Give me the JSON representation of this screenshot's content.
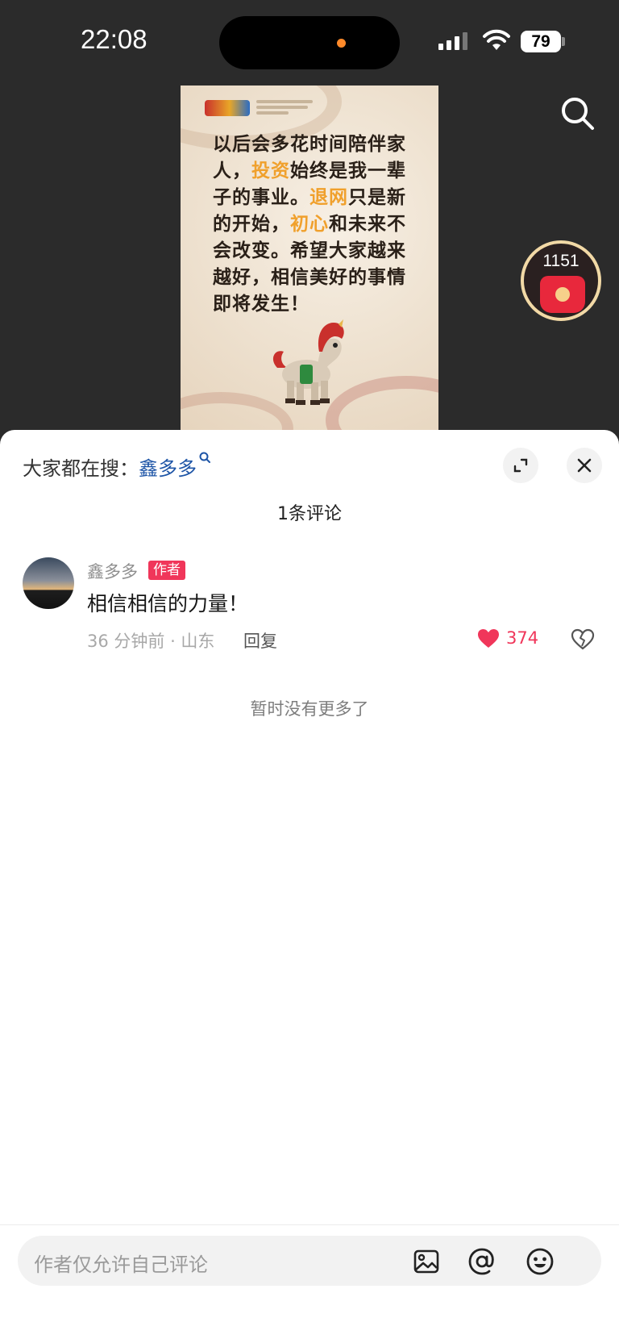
{
  "status_bar": {
    "time": "22:08",
    "battery": "79"
  },
  "poster": {
    "lines": [
      [
        {
          "t": "以后会多花时间陪伴家"
        }
      ],
      [
        {
          "t": "人，"
        },
        {
          "t": "投资",
          "hl": true
        },
        {
          "t": "始终是我一辈"
        }
      ],
      [
        {
          "t": "子的事业。"
        },
        {
          "t": "退网",
          "hl": true
        },
        {
          "t": "只是新"
        }
      ],
      [
        {
          "t": "的开始，"
        },
        {
          "t": "初心",
          "hl": true
        },
        {
          "t": "和未来不"
        }
      ],
      [
        {
          "t": "会改变。希望大家越来"
        }
      ],
      [
        {
          "t": "越好，相信美好的事情"
        }
      ],
      [
        {
          "t": "即将发生！"
        }
      ]
    ],
    "highlight_color": "#f0a02c"
  },
  "red_packet": {
    "count": "1151"
  },
  "sheet": {
    "hot_search_label": "大家都在搜：",
    "hot_search_keyword": "鑫多多",
    "comment_count_label": "1条评论",
    "no_more_label": "暂时没有更多了",
    "input_placeholder": "作者仅允许自己评论"
  },
  "comments": [
    {
      "author": "鑫多多",
      "badge": "作者",
      "text": "相信相信的力量！",
      "meta": "36 分钟前 · 山东",
      "reply_label": "回复",
      "likes": "374"
    }
  ],
  "colors": {
    "accent_red": "#f0365a",
    "keyword_blue": "#1d54a6",
    "like_red": "#f0365a"
  },
  "icons": [
    "search-icon",
    "expand-icon",
    "close-icon",
    "like-heart-icon",
    "dislike-heart-icon",
    "image-icon",
    "at-icon",
    "emoji-icon"
  ]
}
